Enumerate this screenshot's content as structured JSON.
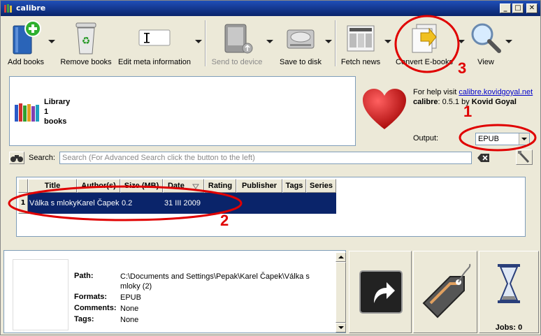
{
  "window": {
    "title": "calibre",
    "min": "_",
    "max": "□",
    "close": "✕"
  },
  "toolbar": {
    "add_books": "Add books",
    "remove_books": "Remove books",
    "edit_meta": "Edit meta information",
    "send_to_device": "Send to device",
    "save_to_disk": "Save to disk",
    "fetch_news": "Fetch news",
    "convert_ebook": "Convert E-books",
    "view": "View"
  },
  "library": {
    "line1": "Library",
    "line2": "1",
    "line3": "books"
  },
  "help": {
    "prefix": "For help visit ",
    "link": "calibre.kovidgoyal.net",
    "app": "calibre",
    "version_text": ": 0.5.1 by ",
    "author": "Kovid Goyal"
  },
  "output": {
    "label": "Output:",
    "value": "EPUB"
  },
  "search": {
    "label": "Search:",
    "placeholder": "Search (For Advanced Search click the button to the left)"
  },
  "table": {
    "headers": [
      "Title",
      "Author(s)",
      "Size (MB)",
      "Date",
      "Rating",
      "Publisher",
      "Tags",
      "Series"
    ],
    "rows": [
      {
        "num": "1",
        "title": "Válka s mloky",
        "author": "Karel Čapek",
        "size": "0.2",
        "date": "31 III 2009"
      }
    ]
  },
  "details": {
    "path_label": "Path:",
    "path_value": "C:\\Documents and Settings\\Pepak\\Karel Čapek\\Válka s mloky (2)",
    "formats_label": "Formats:",
    "formats_value": "EPUB",
    "comments_label": "Comments:",
    "comments_value": "None",
    "tags_label": "Tags:",
    "tags_value": "None"
  },
  "jobs": {
    "text": "Jobs: 0"
  },
  "annotations": {
    "n1": "1",
    "n2": "2",
    "n3": "3",
    "color": "#e00000"
  }
}
